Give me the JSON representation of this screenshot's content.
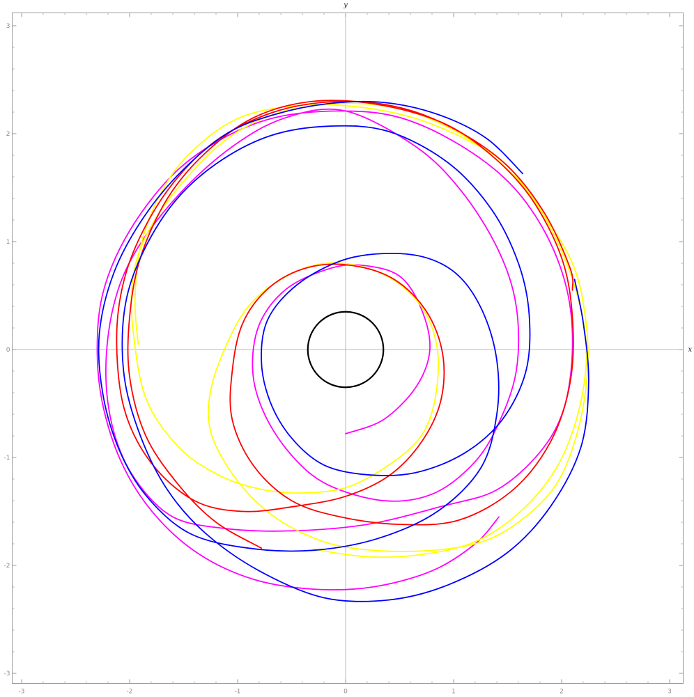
{
  "chart_data": {
    "type": "line",
    "title": "",
    "xlabel": "x",
    "ylabel": "y",
    "xlim": [
      -3.15,
      3.15
    ],
    "ylim": [
      -3.15,
      3.15
    ],
    "x_ticks": [
      -3,
      -2,
      -1,
      0,
      1,
      2,
      3
    ],
    "y_ticks": [
      -3,
      -2,
      -1,
      0,
      1,
      2,
      3
    ],
    "x_tick_labels": [
      "-3",
      "-2",
      "-1",
      "0",
      "1",
      "2",
      "3"
    ],
    "y_tick_labels": [
      "-3",
      "-2",
      "-1",
      "0",
      "1",
      "2",
      "3"
    ],
    "axes_through_origin": true,
    "frame": true,
    "grid": false,
    "legend": "none",
    "circle": {
      "center": [
        0,
        0
      ],
      "radius": 0.35,
      "color": "#000000"
    },
    "series": [
      {
        "color": "#ff00ff",
        "points": [
          [
            0.0,
            -0.78
          ],
          [
            0.35,
            -0.65
          ],
          [
            0.65,
            -0.35
          ],
          [
            0.78,
            0.0
          ],
          [
            0.7,
            0.38
          ],
          [
            0.5,
            0.68
          ],
          [
            0.16,
            0.78
          ],
          [
            -0.15,
            0.75
          ],
          [
            -0.55,
            0.56
          ],
          [
            -0.8,
            0.23
          ],
          [
            -0.86,
            -0.2
          ],
          [
            -0.75,
            -0.6
          ],
          [
            -0.5,
            -0.98
          ],
          [
            -0.17,
            -1.25
          ],
          [
            0.35,
            -1.4
          ],
          [
            0.8,
            -1.34
          ],
          [
            1.17,
            -1.07
          ],
          [
            1.4,
            -0.72
          ],
          [
            1.58,
            -0.2
          ],
          [
            1.58,
            0.4
          ],
          [
            1.41,
            0.93
          ],
          [
            1.07,
            1.47
          ],
          [
            0.65,
            1.88
          ],
          [
            0.0,
            2.21
          ],
          [
            -0.55,
            2.15
          ],
          [
            -1.05,
            1.88
          ],
          [
            -1.55,
            1.43
          ],
          [
            -1.95,
            0.9
          ],
          [
            -2.15,
            0.4
          ],
          [
            -2.22,
            -0.2
          ],
          [
            -2.15,
            -0.75
          ],
          [
            -1.95,
            -1.2
          ],
          [
            -1.6,
            -1.55
          ],
          [
            -1.1,
            -1.66
          ],
          [
            -0.5,
            -1.68
          ],
          [
            0.2,
            -1.62
          ],
          [
            0.9,
            -1.45
          ],
          [
            1.4,
            -1.3
          ],
          [
            1.8,
            -0.95
          ],
          [
            2.02,
            -0.55
          ],
          [
            2.1,
            0.0
          ],
          [
            2.05,
            0.55
          ],
          [
            1.85,
            1.08
          ],
          [
            1.52,
            1.54
          ],
          [
            1.05,
            1.9
          ],
          [
            0.5,
            2.15
          ],
          [
            -0.05,
            2.21
          ],
          [
            -0.65,
            2.15
          ],
          [
            -1.15,
            1.95
          ],
          [
            -1.6,
            1.62
          ],
          [
            -2.0,
            1.1
          ],
          [
            -2.24,
            0.55
          ],
          [
            -2.3,
            0.0
          ],
          [
            -2.24,
            -0.55
          ],
          [
            -2.05,
            -1.1
          ],
          [
            -1.75,
            -1.55
          ],
          [
            -1.35,
            -1.9
          ],
          [
            -0.85,
            -2.13
          ],
          [
            -0.3,
            -2.22
          ],
          [
            0.25,
            -2.2
          ],
          [
            0.8,
            -2.05
          ],
          [
            1.2,
            -1.8
          ],
          [
            1.42,
            -1.55
          ]
        ]
      },
      {
        "color": "#ffff00",
        "points": [
          [
            -1.92,
            0.05
          ],
          [
            -1.95,
            0.45
          ],
          [
            -1.9,
            0.95
          ],
          [
            -1.72,
            1.43
          ],
          [
            -1.45,
            1.81
          ],
          [
            -1.0,
            2.14
          ],
          [
            -0.45,
            2.26
          ],
          [
            0.1,
            2.25
          ],
          [
            0.65,
            2.14
          ],
          [
            1.15,
            1.93
          ],
          [
            1.5,
            1.7
          ],
          [
            1.8,
            1.3
          ],
          [
            2.1,
            0.8
          ],
          [
            2.22,
            0.3
          ],
          [
            2.24,
            -0.2
          ],
          [
            2.15,
            -0.75
          ],
          [
            1.95,
            -1.25
          ],
          [
            1.6,
            -1.6
          ],
          [
            1.2,
            -1.8
          ],
          [
            0.6,
            -1.87
          ],
          [
            0.0,
            -1.83
          ],
          [
            -0.4,
            -1.7
          ],
          [
            -0.75,
            -1.48
          ],
          [
            -1.05,
            -1.15
          ],
          [
            -1.25,
            -0.76
          ],
          [
            -1.25,
            -0.38
          ],
          [
            -1.1,
            0.05
          ],
          [
            -0.9,
            0.4
          ],
          [
            -0.6,
            0.65
          ],
          [
            -0.25,
            0.79
          ],
          [
            0.1,
            0.78
          ],
          [
            0.45,
            0.64
          ],
          [
            0.72,
            0.37
          ],
          [
            0.85,
            0.0
          ],
          [
            0.83,
            -0.45
          ],
          [
            0.7,
            -0.8
          ],
          [
            0.4,
            -1.07
          ],
          [
            0.0,
            -1.28
          ],
          [
            -0.45,
            -1.33
          ],
          [
            -0.85,
            -1.28
          ],
          [
            -1.2,
            -1.15
          ],
          [
            -1.55,
            -0.9
          ],
          [
            -1.85,
            -0.45
          ],
          [
            -1.97,
            0.2
          ],
          [
            -1.97,
            0.65
          ],
          [
            -1.85,
            1.05
          ],
          [
            -1.55,
            1.5
          ],
          [
            -1.1,
            1.95
          ],
          [
            -0.6,
            2.2
          ],
          [
            0.0,
            2.28
          ],
          [
            0.5,
            2.23
          ],
          [
            0.95,
            2.06
          ],
          [
            1.35,
            1.8
          ],
          [
            1.7,
            1.45
          ],
          [
            1.97,
            0.98
          ],
          [
            2.16,
            0.45
          ],
          [
            2.23,
            -0.05
          ],
          [
            2.15,
            -0.6
          ],
          [
            1.95,
            -1.1
          ],
          [
            1.62,
            -1.5
          ],
          [
            1.2,
            -1.78
          ],
          [
            0.7,
            -1.9
          ],
          [
            0.2,
            -1.92
          ],
          [
            -0.3,
            -1.85
          ]
        ]
      },
      {
        "color": "#ff0000",
        "points": [
          [
            -0.78,
            -1.84
          ],
          [
            -1.2,
            -1.6
          ],
          [
            -1.55,
            -1.25
          ],
          [
            -1.85,
            -0.8
          ],
          [
            -2.0,
            -0.25
          ],
          [
            -2.0,
            0.3
          ],
          [
            -1.9,
            0.85
          ],
          [
            -1.65,
            1.4
          ],
          [
            -1.3,
            1.82
          ],
          [
            -0.85,
            2.15
          ],
          [
            -0.3,
            2.3
          ],
          [
            0.3,
            2.27
          ],
          [
            0.9,
            2.1
          ],
          [
            1.35,
            1.8
          ],
          [
            1.72,
            1.4
          ],
          [
            2.0,
            0.85
          ],
          [
            2.1,
            0.3
          ],
          [
            2.08,
            -0.3
          ],
          [
            1.9,
            -0.85
          ],
          [
            1.55,
            -1.3
          ],
          [
            1.05,
            -1.58
          ],
          [
            0.5,
            -1.62
          ],
          [
            -0.05,
            -1.55
          ],
          [
            -0.5,
            -1.4
          ],
          [
            -0.85,
            -1.08
          ],
          [
            -1.05,
            -0.65
          ],
          [
            -1.05,
            -0.2
          ],
          [
            -0.95,
            0.25
          ],
          [
            -0.7,
            0.58
          ],
          [
            -0.35,
            0.76
          ],
          [
            0.05,
            0.78
          ],
          [
            0.45,
            0.65
          ],
          [
            0.75,
            0.35
          ],
          [
            0.9,
            -0.05
          ],
          [
            0.88,
            -0.48
          ],
          [
            0.7,
            -0.86
          ],
          [
            0.4,
            -1.17
          ],
          [
            0.0,
            -1.36
          ],
          [
            -0.45,
            -1.45
          ],
          [
            -0.95,
            -1.5
          ],
          [
            -1.4,
            -1.4
          ],
          [
            -1.8,
            -1.05
          ],
          [
            -2.05,
            -0.55
          ],
          [
            -2.12,
            0.1
          ],
          [
            -2.05,
            0.65
          ],
          [
            -1.85,
            1.15
          ],
          [
            -1.55,
            1.6
          ],
          [
            -1.15,
            1.97
          ],
          [
            -0.6,
            2.22
          ],
          [
            0.0,
            2.3
          ],
          [
            0.55,
            2.23
          ],
          [
            1.05,
            2.02
          ],
          [
            1.5,
            1.7
          ],
          [
            1.85,
            1.25
          ],
          [
            2.08,
            0.75
          ],
          [
            2.1,
            0.55
          ]
        ]
      },
      {
        "color": "#0000ff",
        "points": [
          [
            1.64,
            1.63
          ],
          [
            1.3,
            1.96
          ],
          [
            0.85,
            2.18
          ],
          [
            0.35,
            2.29
          ],
          [
            -0.15,
            2.28
          ],
          [
            -0.65,
            2.18
          ],
          [
            -1.1,
            2.0
          ],
          [
            -1.55,
            1.62
          ],
          [
            -1.9,
            1.18
          ],
          [
            -2.15,
            0.7
          ],
          [
            -2.28,
            0.15
          ],
          [
            -2.25,
            -0.4
          ],
          [
            -2.1,
            -0.92
          ],
          [
            -1.85,
            -1.35
          ],
          [
            -1.45,
            -1.7
          ],
          [
            -0.9,
            -1.84
          ],
          [
            -0.3,
            -1.86
          ],
          [
            0.3,
            -1.75
          ],
          [
            0.85,
            -1.5
          ],
          [
            1.25,
            -1.1
          ],
          [
            1.4,
            -0.6
          ],
          [
            1.4,
            -0.1
          ],
          [
            1.27,
            0.35
          ],
          [
            1.05,
            0.68
          ],
          [
            0.75,
            0.85
          ],
          [
            0.35,
            0.89
          ],
          [
            -0.05,
            0.82
          ],
          [
            -0.45,
            0.6
          ],
          [
            -0.72,
            0.28
          ],
          [
            -0.78,
            -0.1
          ],
          [
            -0.7,
            -0.48
          ],
          [
            -0.5,
            -0.82
          ],
          [
            -0.2,
            -1.07
          ],
          [
            0.2,
            -1.16
          ],
          [
            0.65,
            -1.14
          ],
          [
            1.1,
            -0.96
          ],
          [
            1.45,
            -0.65
          ],
          [
            1.67,
            -0.2
          ],
          [
            1.7,
            0.32
          ],
          [
            1.6,
            0.8
          ],
          [
            1.35,
            1.3
          ],
          [
            0.95,
            1.73
          ],
          [
            0.4,
            2.02
          ],
          [
            -0.15,
            2.07
          ],
          [
            -0.7,
            1.98
          ],
          [
            -1.2,
            1.72
          ],
          [
            -1.6,
            1.35
          ],
          [
            -1.9,
            0.85
          ],
          [
            -2.05,
            0.35
          ],
          [
            -2.05,
            -0.25
          ],
          [
            -1.9,
            -0.8
          ],
          [
            -1.65,
            -1.3
          ],
          [
            -1.3,
            -1.7
          ],
          [
            -0.8,
            -2.05
          ],
          [
            -0.2,
            -2.3
          ],
          [
            0.4,
            -2.32
          ],
          [
            0.95,
            -2.18
          ],
          [
            1.5,
            -1.88
          ],
          [
            1.9,
            -1.45
          ],
          [
            2.18,
            -0.9
          ],
          [
            2.25,
            -0.3
          ],
          [
            2.2,
            0.25
          ],
          [
            2.12,
            0.65
          ]
        ]
      }
    ]
  }
}
